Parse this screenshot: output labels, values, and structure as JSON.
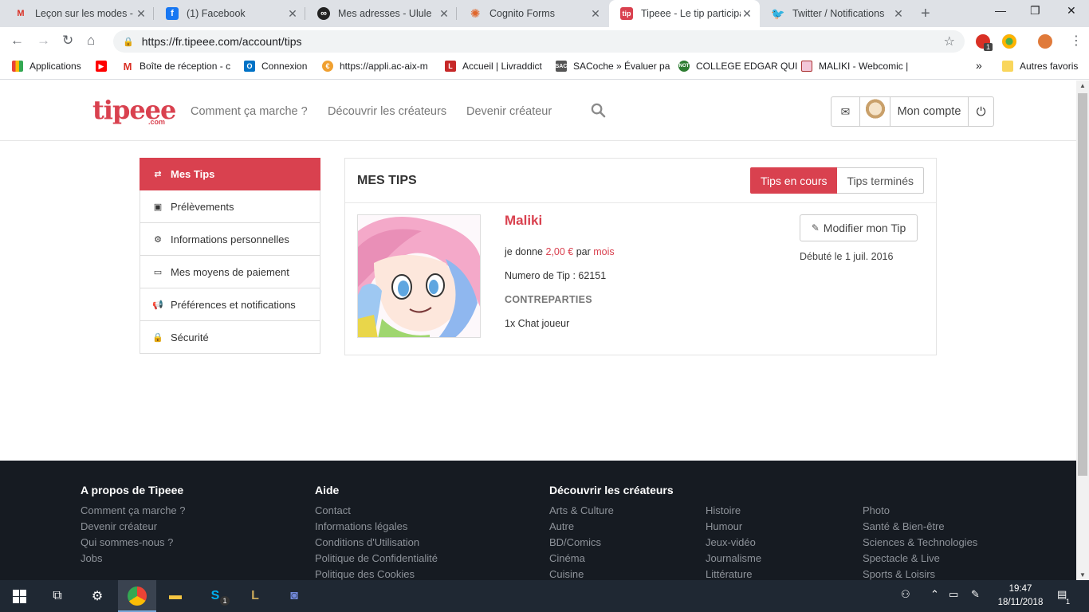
{
  "browser": {
    "tabs": [
      {
        "title": "Leçon sur les modes - c",
        "icon": "gmail-icon",
        "color": "#d93025"
      },
      {
        "title": "(1) Facebook",
        "icon": "facebook-icon",
        "color": "#1877f2"
      },
      {
        "title": "Mes adresses - Ulule",
        "icon": "ulule-icon",
        "color": "#222222"
      },
      {
        "title": "Cognito Forms",
        "icon": "cognito-icon",
        "color": "#e0662b"
      },
      {
        "title": "Tipeee - Le tip participa",
        "icon": "tipeee-icon",
        "color": "#d9414f"
      },
      {
        "title": "Twitter / Notifications",
        "icon": "twitter-icon",
        "color": "#1da1f2"
      }
    ],
    "active_tab": 4,
    "url": "https://fr.tipeee.com/account/tips",
    "extension_badge": "1",
    "bookmarks": [
      {
        "label": "Applications",
        "icon": "apps-grid-icon"
      },
      {
        "label": "",
        "icon": "youtube-icon"
      },
      {
        "label": "Boîte de réception - c",
        "icon": "gmail-icon"
      },
      {
        "label": "Connexion",
        "icon": "outlook-icon"
      },
      {
        "label": "https://appli.ac-aix-m",
        "icon": "euro-icon"
      },
      {
        "label": "Accueil | Livraddict",
        "icon": "livraddict-icon"
      },
      {
        "label": "SACoche » Évaluer pa",
        "icon": "sacoche-icon"
      },
      {
        "label": "COLLEGE EDGAR QUI",
        "icon": "not-icon"
      },
      {
        "label": "MALIKI - Webcomic |",
        "icon": "maliki-icon"
      }
    ],
    "bookmarks_more": "»",
    "other_bookmarks": "Autres favoris"
  },
  "site": {
    "logo": "tipeee",
    "logo_suffix": ".com",
    "nav": [
      "Comment ça marche ?",
      "Découvrir les créateurs",
      "Devenir créateur"
    ],
    "account_label": "Mon compte"
  },
  "sidebar": {
    "items": [
      {
        "label": "Mes Tips",
        "icon": "swap-arrows-icon",
        "active": true
      },
      {
        "label": "Prélèvements",
        "icon": "money-icon",
        "active": false
      },
      {
        "label": "Informations personnelles",
        "icon": "gear-icon",
        "active": false
      },
      {
        "label": "Mes moyens de paiement",
        "icon": "credit-card-icon",
        "active": false
      },
      {
        "label": "Préférences et notifications",
        "icon": "megaphone-icon",
        "active": false
      },
      {
        "label": "Sécurité",
        "icon": "lock-icon",
        "active": false
      }
    ]
  },
  "tips": {
    "title": "MES TIPS",
    "tab_current": "Tips en cours",
    "tab_finished": "Tips terminés",
    "creator": "Maliki",
    "give_prefix": "je donne",
    "amount": "2,00 €",
    "per_word": "par",
    "period": "mois",
    "tip_number_label": "Numero de Tip : 62151",
    "rewards_title": "CONTREPARTIES",
    "reward": "1x Chat joueur",
    "edit_button": "Modifier mon Tip",
    "started": "Débuté le 1 juil. 2016"
  },
  "footer": {
    "columns": [
      {
        "title": "A propos de Tipeee",
        "links": [
          "Comment ça marche ?",
          "Devenir créateur",
          "Qui sommes-nous ?",
          "Jobs"
        ]
      },
      {
        "title": "Aide",
        "links": [
          "Contact",
          "Informations légales",
          "Conditions d'Utilisation",
          "Politique de Confidentialité",
          "Politique des Cookies"
        ]
      },
      {
        "title": "Découvrir les créateurs",
        "links": [
          "Arts & Culture",
          "Autre",
          "BD/Comics",
          "Cinéma",
          "Cuisine"
        ]
      },
      {
        "title": "",
        "links": [
          "Histoire",
          "Humour",
          "Jeux-vidéo",
          "Journalisme",
          "Littérature"
        ]
      },
      {
        "title": "",
        "links": [
          "Photo",
          "Santé & Bien-être",
          "Sciences & Technologies",
          "Spectacle & Live",
          "Sports & Loisirs"
        ]
      }
    ]
  },
  "taskbar": {
    "time": "19:47",
    "date": "18/11/2018",
    "notification_count": "1",
    "skype_badge": "1"
  },
  "colors": {
    "brand": "#d9414f",
    "footer_bg": "#161b22"
  }
}
